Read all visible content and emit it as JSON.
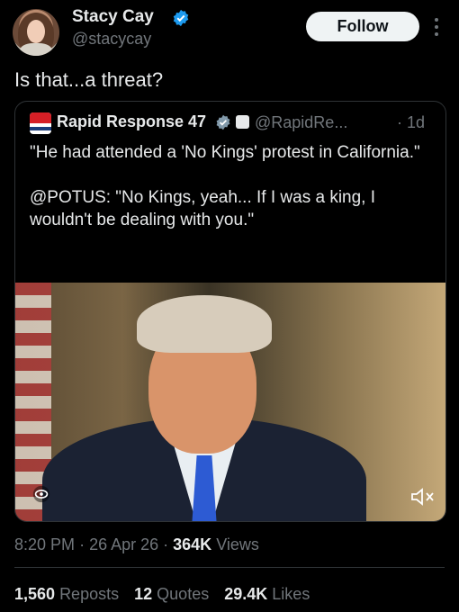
{
  "author": {
    "name": "Stacy Cay",
    "handle": "@stacycay",
    "follow_label": "Follow"
  },
  "tweet": {
    "text": "Is that...a threat?"
  },
  "quoted": {
    "name": "Rapid Response 47",
    "handle": "@RapidRe...",
    "time": "· 1d",
    "paragraph1": "\"He had attended a 'No Kings' protest in California.\"",
    "paragraph2": "@POTUS: \"No Kings, yeah... If I was a king, I wouldn't be dealing with you.\""
  },
  "meta": {
    "time": "8:20 PM",
    "date": "26 Apr 26",
    "views_count": "364K",
    "views_label": "Views"
  },
  "stats": {
    "reposts_count": "1,560",
    "reposts_label": "Reposts",
    "quotes_count": "12",
    "quotes_label": "Quotes",
    "likes_count": "29.4K",
    "likes_label": "Likes"
  },
  "colors": {
    "background": "#000000",
    "verified": "#1d9bf0",
    "secondary_text": "#71767b",
    "primary_text": "#e7e9ea"
  },
  "icons": [
    "verified-badge-icon",
    "more-options-icon",
    "org-badge-icon",
    "alt-text-eye-icon",
    "mute-icon"
  ]
}
